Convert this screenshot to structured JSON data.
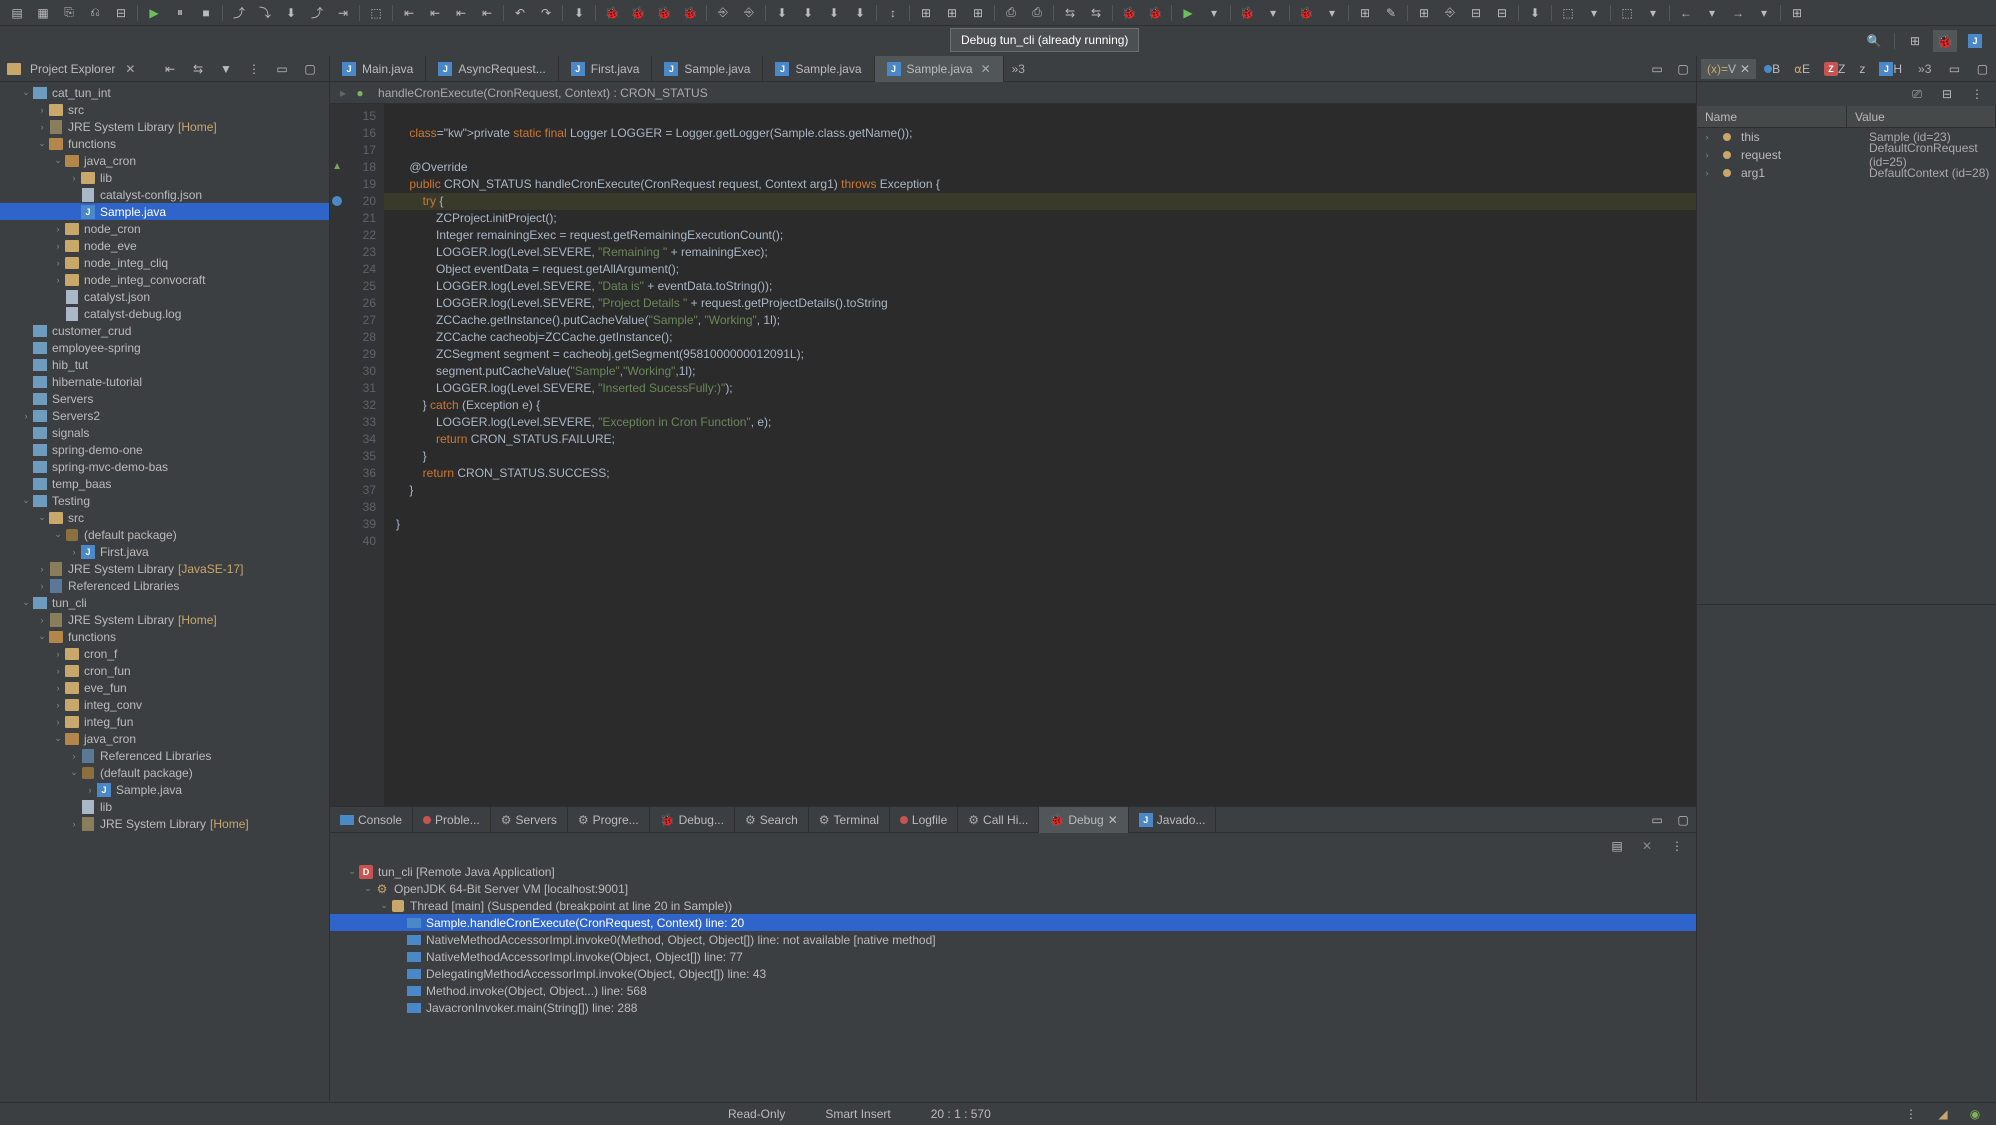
{
  "tooltip": "Debug tun_cli (already running)",
  "explorer": {
    "title": "Project Explorer",
    "tree": [
      {
        "d": 0,
        "e": "v",
        "i": "proj",
        "t": "cat_tun_int"
      },
      {
        "d": 1,
        "e": ">",
        "i": "fold",
        "t": "src"
      },
      {
        "d": 1,
        "e": ">",
        "i": "jar",
        "t": "JRE System Library",
        "suffix": "[Home]",
        "sc": "home"
      },
      {
        "d": 1,
        "e": "v",
        "i": "fold-o",
        "t": "functions"
      },
      {
        "d": 2,
        "e": "v",
        "i": "fold-o",
        "t": "java_cron"
      },
      {
        "d": 3,
        "e": ">",
        "i": "fold",
        "t": "lib"
      },
      {
        "d": 3,
        "e": "",
        "i": "file",
        "t": "catalyst-config.json"
      },
      {
        "d": 3,
        "e": "",
        "i": "j",
        "t": "Sample.java",
        "sel": true
      },
      {
        "d": 2,
        "e": ">",
        "i": "fold",
        "t": "node_cron"
      },
      {
        "d": 2,
        "e": ">",
        "i": "fold",
        "t": "node_eve"
      },
      {
        "d": 2,
        "e": ">",
        "i": "fold",
        "t": "node_integ_cliq"
      },
      {
        "d": 2,
        "e": ">",
        "i": "fold",
        "t": "node_integ_convocraft"
      },
      {
        "d": 2,
        "e": "",
        "i": "file",
        "t": "catalyst.json"
      },
      {
        "d": 2,
        "e": "",
        "i": "file",
        "t": "catalyst-debug.log"
      },
      {
        "d": 0,
        "e": "",
        "i": "proj",
        "t": "customer_crud"
      },
      {
        "d": 0,
        "e": "",
        "i": "proj",
        "t": "employee-spring"
      },
      {
        "d": 0,
        "e": "",
        "i": "proj",
        "t": "hib_tut"
      },
      {
        "d": 0,
        "e": "",
        "i": "proj",
        "t": "hibernate-tutorial"
      },
      {
        "d": 0,
        "e": "",
        "i": "proj",
        "t": "Servers"
      },
      {
        "d": 0,
        "e": ">",
        "i": "proj",
        "t": "Servers2"
      },
      {
        "d": 0,
        "e": "",
        "i": "proj",
        "t": "signals"
      },
      {
        "d": 0,
        "e": "",
        "i": "proj",
        "t": "spring-demo-one"
      },
      {
        "d": 0,
        "e": "",
        "i": "proj",
        "t": "spring-mvc-demo-bas"
      },
      {
        "d": 0,
        "e": "",
        "i": "proj",
        "t": "temp_baas"
      },
      {
        "d": 0,
        "e": "v",
        "i": "proj",
        "t": "Testing"
      },
      {
        "d": 1,
        "e": "v",
        "i": "fold",
        "t": "src"
      },
      {
        "d": 2,
        "e": "v",
        "i": "pkg",
        "t": "(default package)"
      },
      {
        "d": 3,
        "e": ">",
        "i": "j",
        "t": "First.java"
      },
      {
        "d": 1,
        "e": ">",
        "i": "jar",
        "t": "JRE System Library",
        "suffix": "[JavaSE-17]",
        "sc": "javase"
      },
      {
        "d": 1,
        "e": ">",
        "i": "lib",
        "t": "Referenced Libraries"
      },
      {
        "d": 0,
        "e": "v",
        "i": "proj",
        "t": "tun_cli"
      },
      {
        "d": 1,
        "e": ">",
        "i": "jar",
        "t": "JRE System Library",
        "suffix": "[Home]",
        "sc": "home"
      },
      {
        "d": 1,
        "e": "v",
        "i": "fold-o",
        "t": "functions"
      },
      {
        "d": 2,
        "e": ">",
        "i": "fold",
        "t": "cron_f"
      },
      {
        "d": 2,
        "e": ">",
        "i": "fold",
        "t": "cron_fun"
      },
      {
        "d": 2,
        "e": ">",
        "i": "fold",
        "t": "eve_fun"
      },
      {
        "d": 2,
        "e": ">",
        "i": "fold",
        "t": "integ_conv"
      },
      {
        "d": 2,
        "e": ">",
        "i": "fold",
        "t": "integ_fun"
      },
      {
        "d": 2,
        "e": "v",
        "i": "fold-o",
        "t": "java_cron"
      },
      {
        "d": 3,
        "e": ">",
        "i": "lib",
        "t": "Referenced Libraries"
      },
      {
        "d": 3,
        "e": "v",
        "i": "pkg",
        "t": "(default package)"
      },
      {
        "d": 4,
        "e": ">",
        "i": "j",
        "t": "Sample.java"
      },
      {
        "d": 3,
        "e": "",
        "i": "file",
        "t": "lib"
      },
      {
        "d": 3,
        "e": ">",
        "i": "jar",
        "t": "JRE System Library",
        "suffix": "[Home]",
        "sc": "home"
      }
    ]
  },
  "editor": {
    "tabs": [
      {
        "l": "Main.java",
        "i": "j"
      },
      {
        "l": "AsyncRequest...",
        "i": "j"
      },
      {
        "l": "First.java",
        "i": "j"
      },
      {
        "l": "Sample.java",
        "i": "j"
      },
      {
        "l": "Sample.java",
        "i": "j"
      },
      {
        "l": "Sample.java",
        "i": "j",
        "active": true,
        "close": true
      }
    ],
    "tab_extra": "»3",
    "breadcrumb": [
      "handleCronExecute(CronRequest, Context) : CRON_STATUS"
    ],
    "first_ln": 15,
    "lines": [
      {
        "t": "",
        "h": []
      },
      {
        "t": "    private static final Logger LOGGER = Logger.getLogger(Sample.class.getName());",
        "kw": [
          "private",
          "static",
          "final"
        ],
        "cl": [
          "class"
        ]
      },
      {
        "t": ""
      },
      {
        "t": "    @Override",
        "ov": true
      },
      {
        "t": "    public CRON_STATUS handleCronExecute(CronRequest request, Context arg1) throws Exception {",
        "kw": [
          "public",
          "throws"
        ]
      },
      {
        "t": "        try {",
        "kw": [
          "try"
        ],
        "hl": true,
        "bp": true
      },
      {
        "t": "            ZCProject.initProject();"
      },
      {
        "t": "            Integer remainingExec = request.getRemainingExecutionCount();"
      },
      {
        "t": "            LOGGER.log(Level.SEVERE, \"Remaining \" + remainingExec);",
        "str": [
          "\"Remaining \""
        ]
      },
      {
        "t": "            Object eventData = request.getAllArgument();"
      },
      {
        "t": "            LOGGER.log(Level.SEVERE, \"Data is\" + eventData.toString());",
        "str": [
          "\"Data is\""
        ]
      },
      {
        "t": "            LOGGER.log(Level.SEVERE, \"Project Details \" + request.getProjectDetails().toString",
        "str": [
          "\"Project Details \""
        ]
      },
      {
        "t": "            ZCCache.getInstance().putCacheValue(\"Sample\", \"Working\", 1l);",
        "str": [
          "\"Sample\"",
          "\"Working\""
        ]
      },
      {
        "t": "            ZCCache cacheobj=ZCCache.getInstance();"
      },
      {
        "t": "            ZCSegment segment = cacheobj.getSegment(9581000000012091L);"
      },
      {
        "t": "            segment.putCacheValue(\"Sample\",\"Working\",1l);",
        "str": [
          "\"Sample\"",
          "\"Working\""
        ]
      },
      {
        "t": "            LOGGER.log(Level.SEVERE, \"Inserted SucessFully:)\");",
        "str": [
          "\"Inserted SucessFully:)\""
        ]
      },
      {
        "t": "        } catch (Exception e) {",
        "kw": [
          "catch"
        ]
      },
      {
        "t": "            LOGGER.log(Level.SEVERE, \"Exception in Cron Function\", e);",
        "str": [
          "\"Exception in Cron Function\""
        ]
      },
      {
        "t": "            return CRON_STATUS.FAILURE;",
        "kw": [
          "return"
        ]
      },
      {
        "t": "        }"
      },
      {
        "t": "        return CRON_STATUS.SUCCESS;",
        "kw": [
          "return"
        ]
      },
      {
        "t": "    }"
      },
      {
        "t": ""
      },
      {
        "t": "}"
      },
      {
        "t": ""
      }
    ]
  },
  "bottom": {
    "tabs": [
      {
        "l": "Console",
        "i": "frame"
      },
      {
        "l": "Proble...",
        "i": "dot"
      },
      {
        "l": "Servers",
        "i": "gear"
      },
      {
        "l": "Progre...",
        "i": "gear"
      },
      {
        "l": "Debug...",
        "i": "bug"
      },
      {
        "l": "Search",
        "i": "gear"
      },
      {
        "l": "Terminal",
        "i": "gear"
      },
      {
        "l": "Logfile",
        "i": "dot"
      },
      {
        "l": "Call Hi...",
        "i": "gear"
      },
      {
        "l": "Debug",
        "i": "bug",
        "active": true,
        "close": true
      },
      {
        "l": "Javado...",
        "i": "j"
      }
    ],
    "debug_tree": [
      {
        "d": 0,
        "e": "v",
        "i": "d",
        "t": "tun_cli [Remote Java Application]"
      },
      {
        "d": 1,
        "e": "v",
        "i": "gear",
        "t": "OpenJDK 64-Bit Server VM [localhost:9001]"
      },
      {
        "d": 2,
        "e": "v",
        "i": "thr",
        "t": "Thread [main] (Suspended (breakpoint at line 20 in Sample))"
      },
      {
        "d": 3,
        "e": "",
        "i": "frame",
        "t": "Sample.handleCronExecute(CronRequest, Context) line: 20",
        "sel": true
      },
      {
        "d": 3,
        "e": "",
        "i": "frame",
        "t": "NativeMethodAccessorImpl.invoke0(Method, Object, Object[]) line: not available [native method]"
      },
      {
        "d": 3,
        "e": "",
        "i": "frame",
        "t": "NativeMethodAccessorImpl.invoke(Object, Object[]) line: 77"
      },
      {
        "d": 3,
        "e": "",
        "i": "frame",
        "t": "DelegatingMethodAccessorImpl.invoke(Object, Object[]) line: 43"
      },
      {
        "d": 3,
        "e": "",
        "i": "frame",
        "t": "Method.invoke(Object, Object...) line: 568"
      },
      {
        "d": 3,
        "e": "",
        "i": "frame",
        "t": "JavacronInvoker.main(String[]) line: 288"
      }
    ]
  },
  "variables": {
    "tab_label": "V",
    "other_tabs": [
      "B",
      "E",
      "Z",
      "z",
      "H"
    ],
    "extra": "»3",
    "cols": {
      "name": "Name",
      "value": "Value"
    },
    "rows": [
      {
        "n": "this",
        "v": "Sample  (id=23)"
      },
      {
        "n": "request",
        "v": "DefaultCronRequest  (id=25)"
      },
      {
        "n": "arg1",
        "v": "DefaultContext  (id=28)"
      }
    ]
  },
  "status": {
    "readonly": "Read-Only",
    "insert": "Smart Insert",
    "pos": "20 : 1 : 570"
  }
}
